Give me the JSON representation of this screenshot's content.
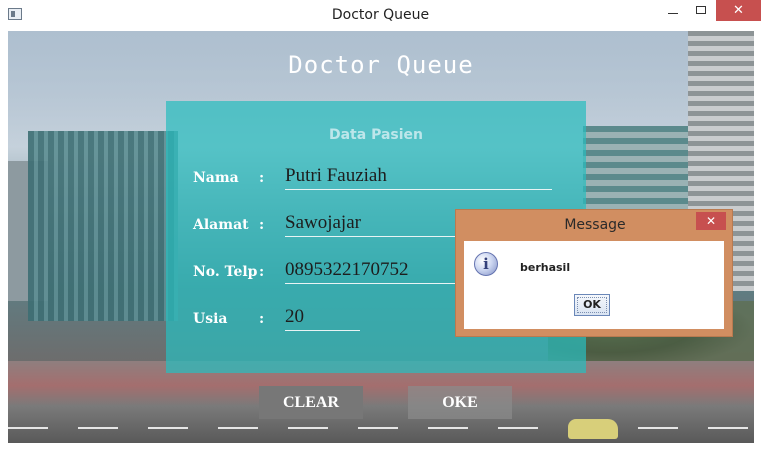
{
  "window": {
    "title": "Doctor Queue",
    "close_glyph": "✕"
  },
  "app": {
    "heading": "Doctor Queue"
  },
  "panel": {
    "title": "Data Pasien",
    "fields": [
      {
        "label": "Nama",
        "colon": ":",
        "value": "Putri Fauziah"
      },
      {
        "label": "Alamat",
        "colon": ":",
        "value": "Sawojajar"
      },
      {
        "label": "No. Telp",
        "colon": ":",
        "value": "0895322170752"
      },
      {
        "label": "Usia",
        "colon": ":",
        "value": "20"
      }
    ]
  },
  "buttons": {
    "clear": "CLEAR",
    "oke": "OKE"
  },
  "dialog": {
    "title": "Message",
    "close_glyph": "✕",
    "icon_glyph": "i",
    "message": "berhasil",
    "ok_label": "OK"
  }
}
